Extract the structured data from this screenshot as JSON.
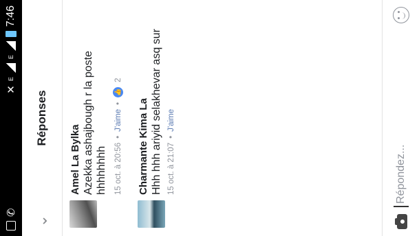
{
  "status": {
    "time": "7:46",
    "network_a": "E",
    "network_b": "E"
  },
  "header": {
    "title": "Réponses"
  },
  "comments": [
    {
      "author": "Amel La Bylka",
      "text": "Azekka ashajbough r la poste hhhhhhhh",
      "time": "15 oct. à 20:56",
      "like_label": "J'aime",
      "likes": "2"
    },
    {
      "author": "Charmante Kima La",
      "text": "Hhh hhh ariyid selakhevar asq sur",
      "time": "15 oct. à 21:07",
      "like_label": "J'aime"
    }
  ],
  "composer": {
    "placeholder": "Répondez..."
  },
  "colors": {
    "accent": "#4a89f3",
    "link": "#5b7bb2",
    "muted": "#90949c"
  }
}
